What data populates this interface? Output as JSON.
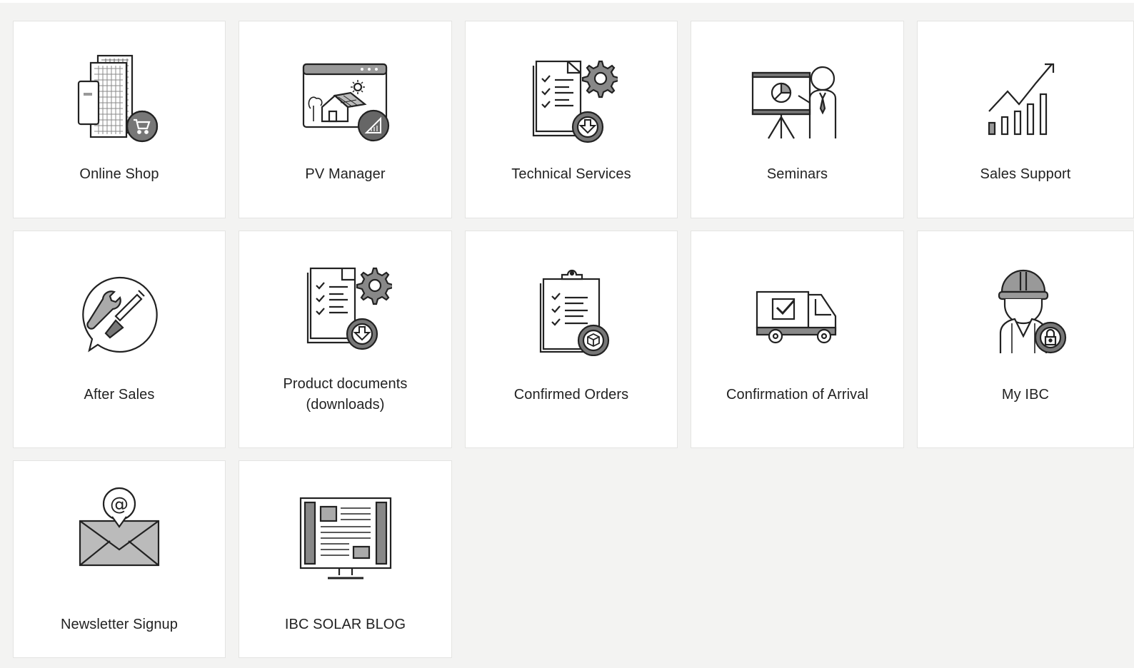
{
  "tiles": [
    {
      "label": "Online Shop",
      "icon": "online-shop-icon"
    },
    {
      "label": "PV Manager",
      "icon": "pv-manager-icon"
    },
    {
      "label": "Technical Services",
      "icon": "technical-services-icon"
    },
    {
      "label": "Seminars",
      "icon": "seminars-icon"
    },
    {
      "label": "Sales Support",
      "icon": "sales-support-icon"
    },
    {
      "label": "After Sales",
      "icon": "after-sales-icon"
    },
    {
      "label": "Product documents",
      "label2": "(downloads)",
      "icon": "product-documents-icon"
    },
    {
      "label": "Confirmed Orders",
      "icon": "confirmed-orders-icon"
    },
    {
      "label": "Confirmation of Arrival",
      "icon": "delivery-truck-icon"
    },
    {
      "label": "My IBC",
      "icon": "my-ibc-icon"
    },
    {
      "label": "Newsletter Signup",
      "icon": "newsletter-icon"
    },
    {
      "label": "IBC SOLAR BLOG",
      "icon": "blog-icon"
    }
  ],
  "colors": {
    "background": "#f3f3f2",
    "tile": "#ffffff",
    "border": "#e4e4e2",
    "icon_stroke": "#222222",
    "icon_fill": "#b5b5b5"
  }
}
